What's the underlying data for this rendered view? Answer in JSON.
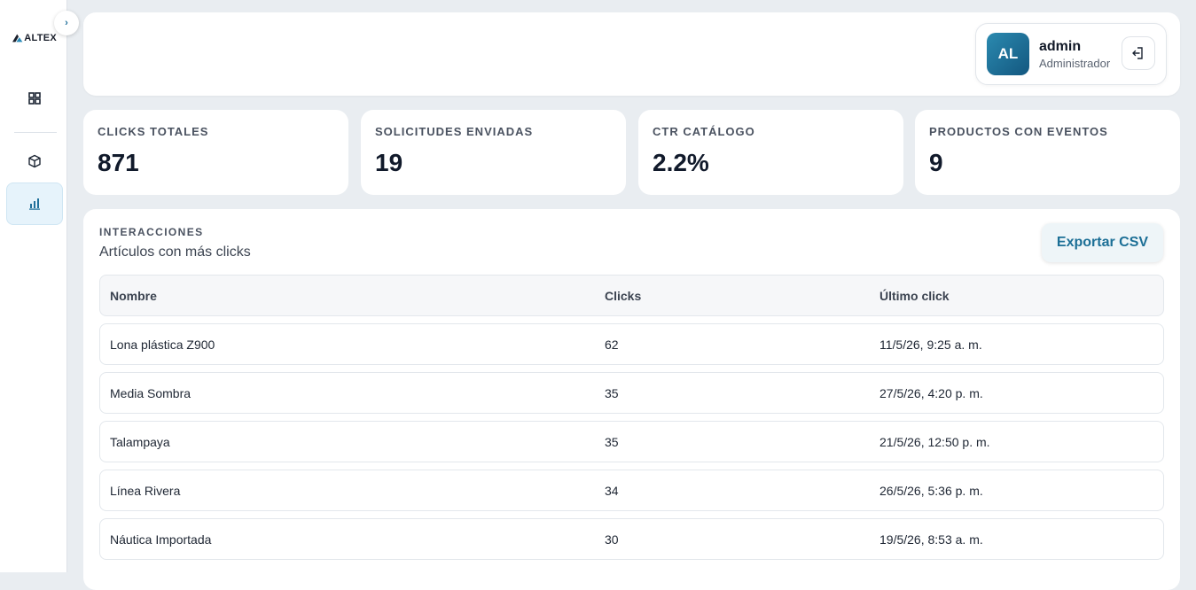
{
  "brand": {
    "logo_text": "ALTEX"
  },
  "sidebar": {
    "collapse_label": "›",
    "items": [
      {
        "icon": "grid-icon",
        "active": false
      },
      {
        "icon": "box-icon",
        "active": false
      },
      {
        "icon": "bar-chart-icon",
        "active": true
      }
    ]
  },
  "user": {
    "initials": "AL",
    "name": "admin",
    "role": "Administrador"
  },
  "stats": [
    {
      "label": "CLICKS TOTALES",
      "value": "871"
    },
    {
      "label": "SOLICITUDES ENVIADAS",
      "value": "19"
    },
    {
      "label": "CTR CATÁLOGO",
      "value": "2.2%"
    },
    {
      "label": "PRODUCTOS CON EVENTOS",
      "value": "9"
    }
  ],
  "section": {
    "eyebrow": "INTERACCIONES",
    "title": "Artículos con más clicks",
    "export_label": "Exportar CSV"
  },
  "table": {
    "columns": [
      "Nombre",
      "Clicks",
      "Último click"
    ],
    "rows": [
      {
        "name": "Lona plástica Z900",
        "clicks": "62",
        "last": "11/5/26, 9:25 a. m."
      },
      {
        "name": "Media Sombra",
        "clicks": "35",
        "last": "27/5/26, 4:20 p. m."
      },
      {
        "name": "Talampaya",
        "clicks": "35",
        "last": "21/5/26, 12:50 p. m."
      },
      {
        "name": "Línea Rivera",
        "clicks": "34",
        "last": "26/5/26, 5:36 p. m."
      },
      {
        "name": "Náutica Importada",
        "clicks": "30",
        "last": "19/5/26, 8:53 a. m."
      }
    ]
  }
}
